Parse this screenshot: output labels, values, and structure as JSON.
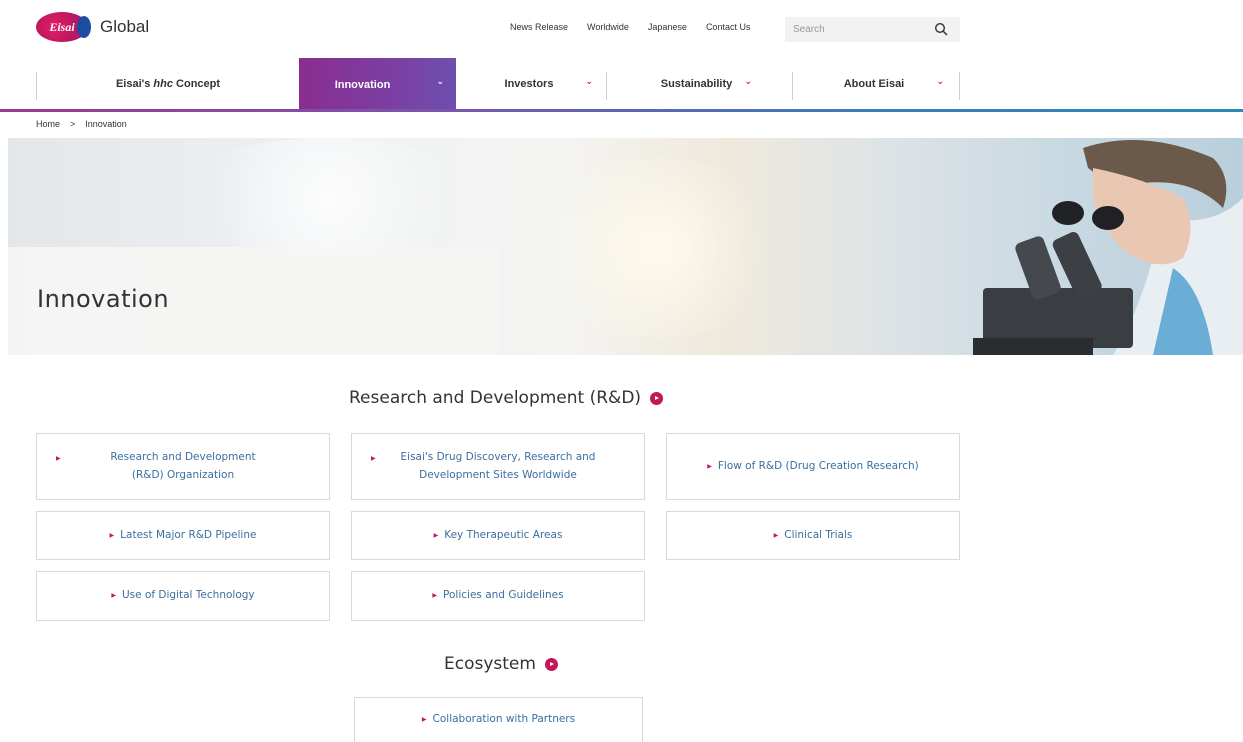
{
  "header": {
    "logo_text": "Eisai",
    "site_name": "Global",
    "utility_links": [
      "News Release",
      "Worldwide",
      "Japanese",
      "Contact Us"
    ],
    "search_placeholder": "Search"
  },
  "nav": {
    "items": [
      {
        "label_prefix": "Eisai's ",
        "label_em": "hhc",
        "label_suffix": " Concept",
        "has_chevron": false
      },
      {
        "label": "Innovation",
        "has_chevron": true,
        "active": true
      },
      {
        "label": "Investors",
        "has_chevron": true
      },
      {
        "label": "Sustainability",
        "has_chevron": true
      },
      {
        "label": "About Eisai",
        "has_chevron": true
      }
    ],
    "chevron": "⌄"
  },
  "breadcrumb": {
    "home": "Home",
    "separator": ">",
    "current": "Innovation"
  },
  "hero": {
    "title": "Innovation"
  },
  "rd_section": {
    "title": "Research and Development (R&D)",
    "cards": [
      "Research and Development (R&D) Organization",
      "Eisai's Drug Discovery, Research and Development Sites Worldwide",
      "Flow of R&D (Drug Creation Research)",
      "Latest Major R&D Pipeline",
      "Key Therapeutic Areas",
      "Clinical Trials",
      "Use of Digital Technology",
      "Policies and Guidelines"
    ]
  },
  "eco_section": {
    "title": "Ecosystem",
    "cards": [
      "Collaboration with Partners"
    ]
  },
  "colors": {
    "accent_magenta": "#c2185b",
    "nav_active": "#7b3fa3",
    "link_blue": "#3b6e9e"
  }
}
